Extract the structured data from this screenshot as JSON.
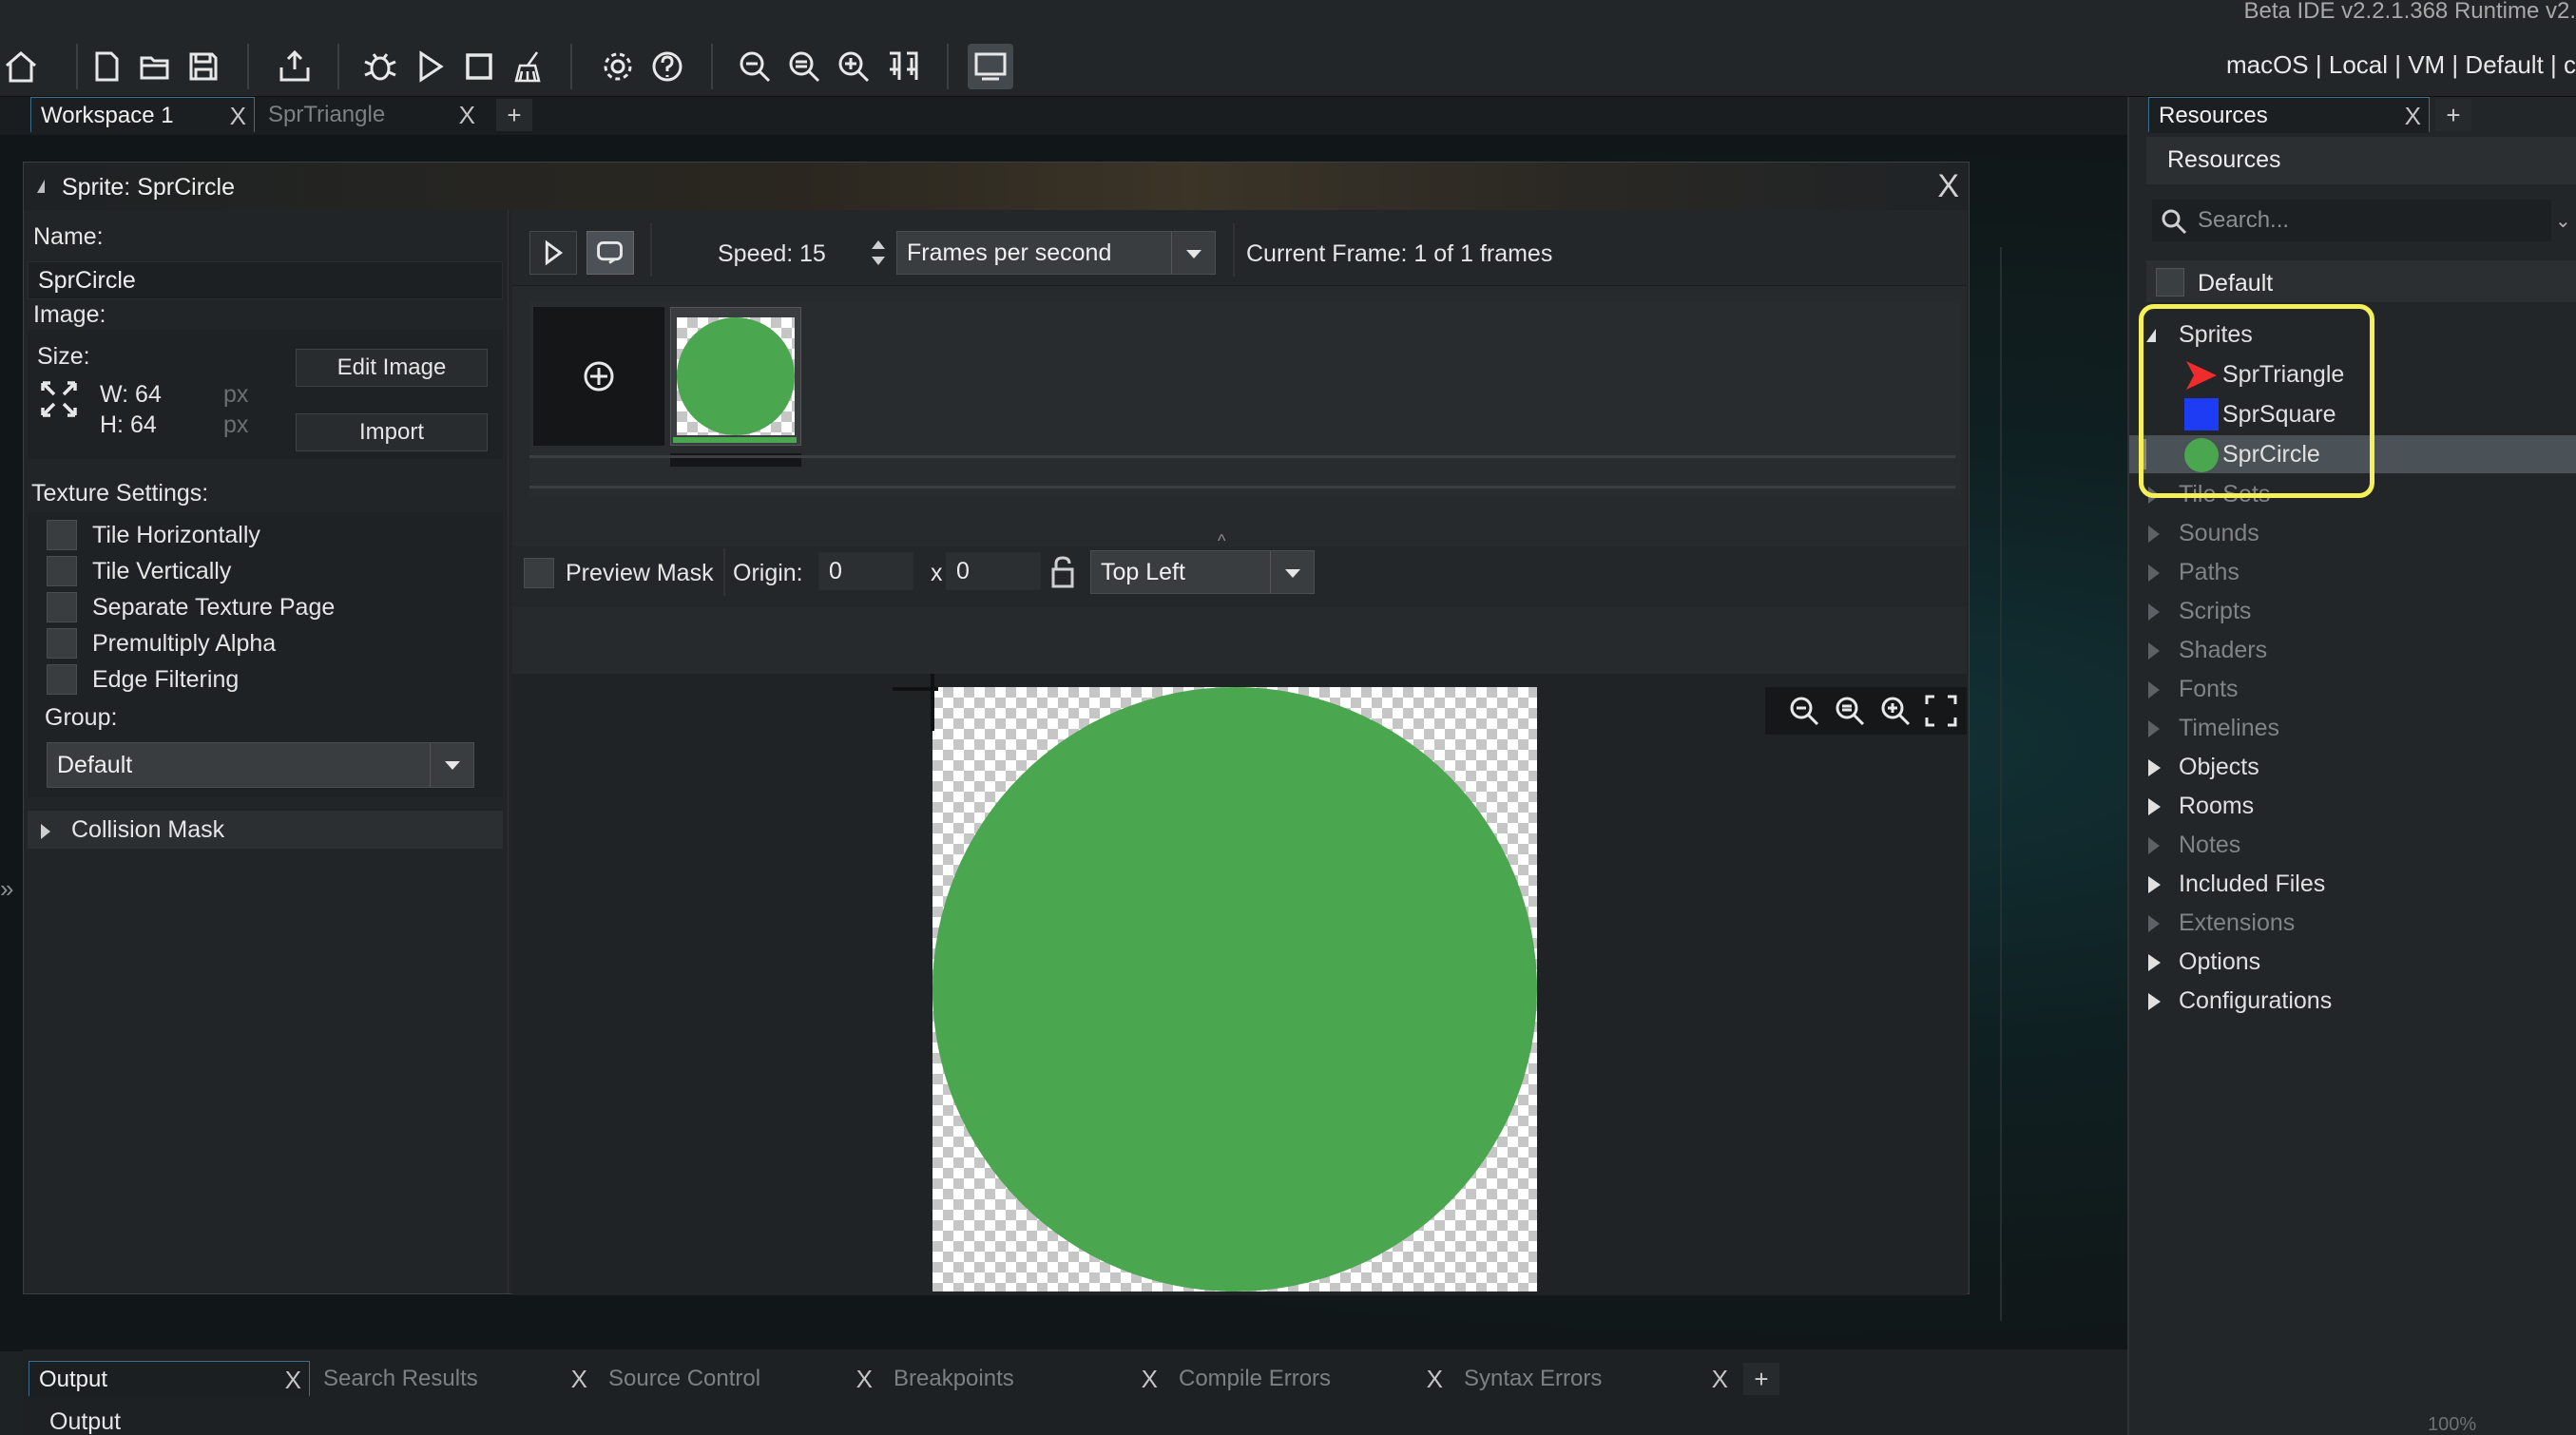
{
  "header": {
    "version": "Beta IDE v2.2.1.368  Runtime v2.",
    "target": "macOS | Local | VM | Default | c"
  },
  "toolbar": {
    "icons": [
      "home-icon",
      "new-file-icon",
      "open-folder-icon",
      "save-icon",
      "export-icon",
      "debug-icon",
      "run-icon",
      "stop-icon",
      "clean-icon",
      "settings-icon",
      "help-icon",
      "zoom-out-icon",
      "zoom-reset-icon",
      "zoom-in-icon",
      "layout-icon",
      "monitor-icon"
    ]
  },
  "workspace_tabs": [
    {
      "label": "Workspace 1",
      "active": true
    },
    {
      "label": "SprTriangle",
      "active": false
    }
  ],
  "tab_add_label": "+",
  "sprite_editor": {
    "title": "Sprite: SprCircle",
    "close_label": "X",
    "name_label": "Name:",
    "name_value": "SprCircle",
    "image_label": "Image:",
    "size_label": "Size:",
    "width_text": "W: 64",
    "height_text": "H: 64",
    "unit": "px",
    "edit_image_button": "Edit Image",
    "import_button": "Import",
    "texture_settings_label": "Texture Settings:",
    "checkboxes": [
      {
        "label": "Tile Horizontally",
        "checked": false
      },
      {
        "label": "Tile Vertically",
        "checked": false
      },
      {
        "label": "Separate Texture Page",
        "checked": false
      },
      {
        "label": "Premultiply Alpha",
        "checked": false
      },
      {
        "label": "Edge Filtering",
        "checked": false
      }
    ],
    "group_label": "Group:",
    "group_value": "Default",
    "collision_mask_label": "Collision Mask",
    "speed_label": "Speed:",
    "speed_value": "15",
    "speed_unit": "Frames per second",
    "current_frame": "Current Frame: 1 of 1 frames",
    "preview_mask_label": "Preview Mask",
    "origin_label": "Origin:",
    "origin_x": "0",
    "origin_sep": "x",
    "origin_y": "0",
    "origin_preset": "Top Left",
    "sprite_color": "#4aa64f"
  },
  "resources": {
    "tab_label": "Resources",
    "header": "Resources",
    "search_placeholder": "Search...",
    "view_name": "Default",
    "sprites_label": "Sprites",
    "sprites": [
      {
        "name": "SprTriangle",
        "icon": "red-triangle",
        "color": "#ee2c2c"
      },
      {
        "name": "SprSquare",
        "icon": "blue-square",
        "color": "#1f3cf5"
      },
      {
        "name": "SprCircle",
        "icon": "green-circle",
        "color": "#4aa64f",
        "selected": true
      }
    ],
    "groups": [
      {
        "name": "Tile Sets",
        "dim": true
      },
      {
        "name": "Sounds",
        "dim": true
      },
      {
        "name": "Paths",
        "dim": true
      },
      {
        "name": "Scripts",
        "dim": true
      },
      {
        "name": "Shaders",
        "dim": true
      },
      {
        "name": "Fonts",
        "dim": true
      },
      {
        "name": "Timelines",
        "dim": true
      },
      {
        "name": "Objects",
        "dim": false
      },
      {
        "name": "Rooms",
        "dim": false
      },
      {
        "name": "Notes",
        "dim": true
      },
      {
        "name": "Included Files",
        "dim": false
      },
      {
        "name": "Extensions",
        "dim": true
      },
      {
        "name": "Options",
        "dim": false
      },
      {
        "name": "Configurations",
        "dim": false
      }
    ],
    "zoom": "100%"
  },
  "bottom_tabs": [
    {
      "label": "Output",
      "active": true
    },
    {
      "label": "Search Results",
      "active": false
    },
    {
      "label": "Source Control",
      "active": false
    },
    {
      "label": "Breakpoints",
      "active": false
    },
    {
      "label": "Compile Errors",
      "active": false
    },
    {
      "label": "Syntax Errors",
      "active": false
    }
  ],
  "output_label": "Output"
}
